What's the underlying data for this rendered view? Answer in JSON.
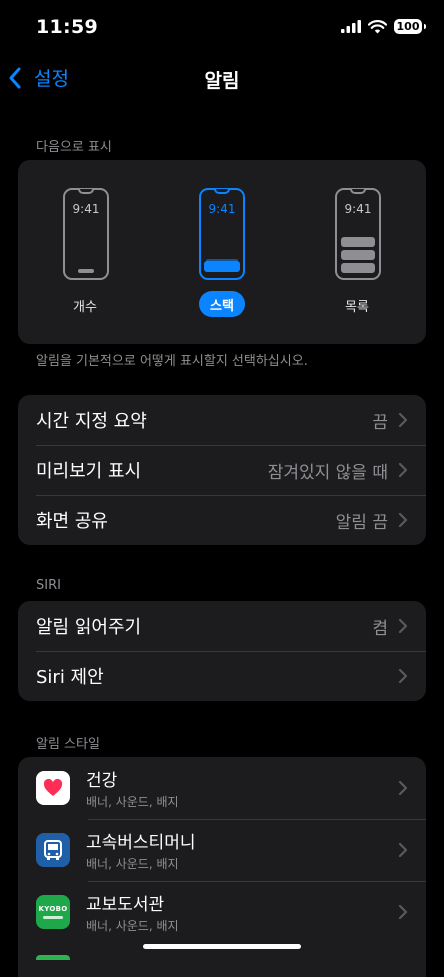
{
  "status_bar": {
    "time": "11:59",
    "battery": "100"
  },
  "nav": {
    "back_label": "설정",
    "title": "알림"
  },
  "display_as": {
    "header": "다음으로 표시",
    "options": [
      {
        "label": "개수",
        "time": "9:41",
        "selected": false
      },
      {
        "label": "스택",
        "time": "9:41",
        "selected": true
      },
      {
        "label": "목록",
        "time": "9:41",
        "selected": false
      }
    ],
    "footer": "알림을 기본적으로 어떻게 표시할지 선택하십시오."
  },
  "general": [
    {
      "label": "시간 지정 요약",
      "value": "끔"
    },
    {
      "label": "미리보기 표시",
      "value": "잠겨있지 않을 때"
    },
    {
      "label": "화면 공유",
      "value": "알림 끔"
    }
  ],
  "siri": {
    "header": "SIRI",
    "rows": [
      {
        "label": "알림 읽어주기",
        "value": "켬"
      },
      {
        "label": "Siri 제안",
        "value": ""
      }
    ]
  },
  "notification_style": {
    "header": "알림 스타일",
    "apps": [
      {
        "name": "건강",
        "detail": "배너, 사운드, 배지",
        "icon": "health-heart-icon"
      },
      {
        "name": "고속버스티머니",
        "detail": "배너, 사운드, 배지",
        "icon": "bus-icon"
      },
      {
        "name": "교보도서관",
        "detail": "배너, 사운드, 배지",
        "icon": "kyobo-library-icon",
        "icon_text": "KYOBO"
      }
    ]
  },
  "colors": {
    "accent": "#0a84ff",
    "background": "#000000",
    "card": "#1c1c1e",
    "secondary_text": "#8e8e93"
  }
}
